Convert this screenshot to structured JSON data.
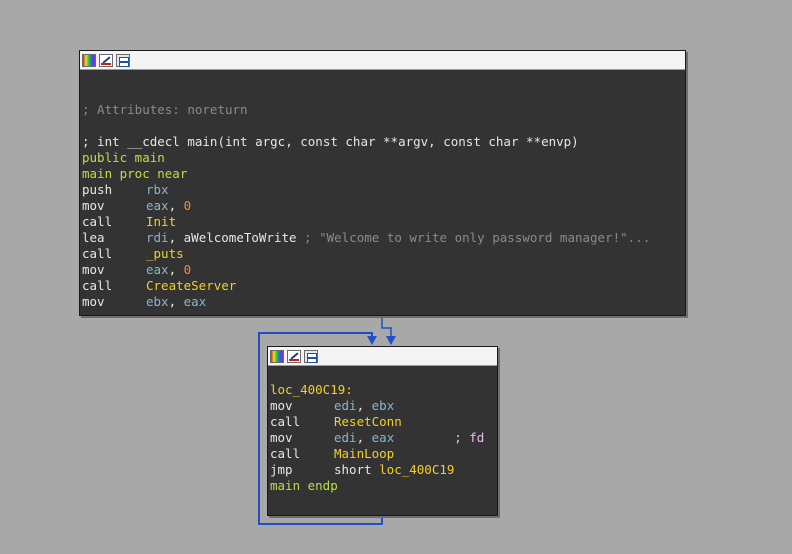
{
  "window": {
    "title_icons": [
      "color-palette-icon",
      "edit-pen-icon",
      "graph-view-icon"
    ]
  },
  "node1": {
    "blank": "",
    "attributes_comment": "; Attributes: noreturn",
    "signature": "; int __cdecl main(int argc, const char **argv, const char **envp)",
    "public_label": "public main",
    "proc_label": "main proc near",
    "instructions": [
      {
        "mn": "push",
        "op1": "rbx",
        "sep": "",
        "op2": "",
        "comment": ""
      },
      {
        "mn": "mov",
        "op1": "eax",
        "sep": ", ",
        "op2": "0",
        "comment": ""
      },
      {
        "mn": "call",
        "op1": "Init",
        "sep": "",
        "op2": "",
        "comment": ""
      },
      {
        "mn": "lea",
        "op1": "rdi",
        "sep": ", ",
        "op2": "aWelcomeToWrite",
        "comment": " ; \"Welcome to write only password manager!\"..."
      },
      {
        "mn": "call",
        "op1": "_puts",
        "sep": "",
        "op2": "",
        "comment": ""
      },
      {
        "mn": "mov",
        "op1": "eax",
        "sep": ", ",
        "op2": "0",
        "comment": ""
      },
      {
        "mn": "call",
        "op1": "CreateServer",
        "sep": "",
        "op2": "",
        "comment": ""
      },
      {
        "mn": "mov",
        "op1": "ebx",
        "sep": ", ",
        "op2": "eax",
        "comment": ""
      }
    ]
  },
  "node2": {
    "label": "loc_400C19:",
    "instructions": [
      {
        "mn": "mov",
        "op1": "edi",
        "sep": ", ",
        "op2": "ebx",
        "comment": ""
      },
      {
        "mn": "call",
        "op1": "ResetConn",
        "sep": "",
        "op2": "",
        "comment": ""
      },
      {
        "mn": "mov",
        "op1": "edi",
        "sep": ", ",
        "op2": "eax",
        "comment": "; fd"
      },
      {
        "mn": "call",
        "op1": "MainLoop",
        "sep": "",
        "op2": "",
        "comment": ""
      },
      {
        "mn": "jmp",
        "op1": "short ",
        "sep": "",
        "op2": "loc_400C19",
        "comment": ""
      }
    ],
    "endp": "main endp"
  },
  "colors": {
    "background": "#a8a8a8",
    "node_bg": "#333333",
    "edge": "#2050c8"
  }
}
